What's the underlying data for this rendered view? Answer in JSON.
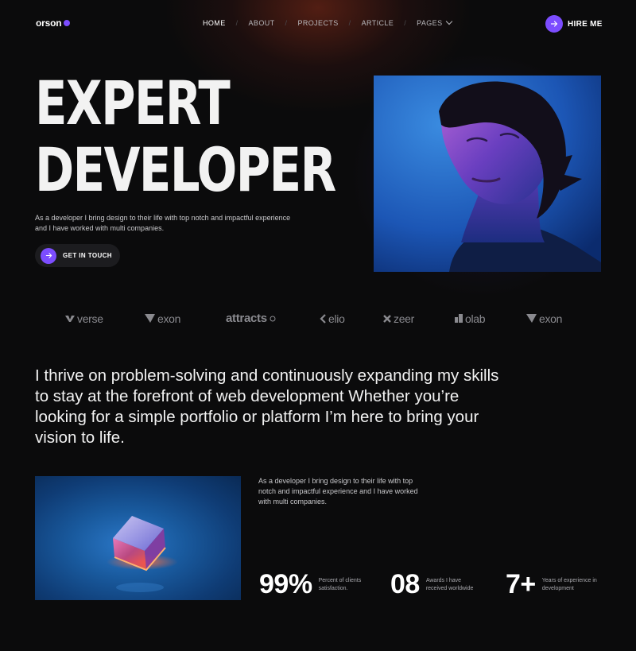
{
  "nav": {
    "logo": "orson",
    "items": [
      {
        "label": "HOME",
        "active": true
      },
      {
        "label": "ABOUT",
        "active": false
      },
      {
        "label": "PROJECTS",
        "active": false
      },
      {
        "label": "ARTICLE",
        "active": false
      },
      {
        "label": "PAGES",
        "active": false
      }
    ],
    "separator": "/",
    "cta_label": "HIRE ME"
  },
  "hero": {
    "title_line1": "EXPERT",
    "title_line2": "DEVELOPER",
    "description": "As a developer I bring design to their life with top notch and impactful experience and I have worked with multi companies.",
    "cta_label": "GET IN TOUCH"
  },
  "brands": [
    "verse",
    "exon",
    "attracts",
    "elio",
    "zeer",
    "olab",
    "exon"
  ],
  "statement": "I thrive on problem-solving and continuously expanding my skills to stay at the forefront of web development Whether you’re looking for a simple portfolio or platform I’m here to bring your vision to life.",
  "about": {
    "description": "As a developer I bring design to their life with top notch and impactful experience and I have worked with multi companies."
  },
  "stats": [
    {
      "value": "99%",
      "label": "Percent of clients satisfaction."
    },
    {
      "value": "08",
      "label": "Awards I have received worldwide"
    },
    {
      "value": "7+",
      "label": "Years of experience in development"
    }
  ],
  "colors": {
    "accent": "#7c4dff",
    "background": "#0b0b0c"
  }
}
